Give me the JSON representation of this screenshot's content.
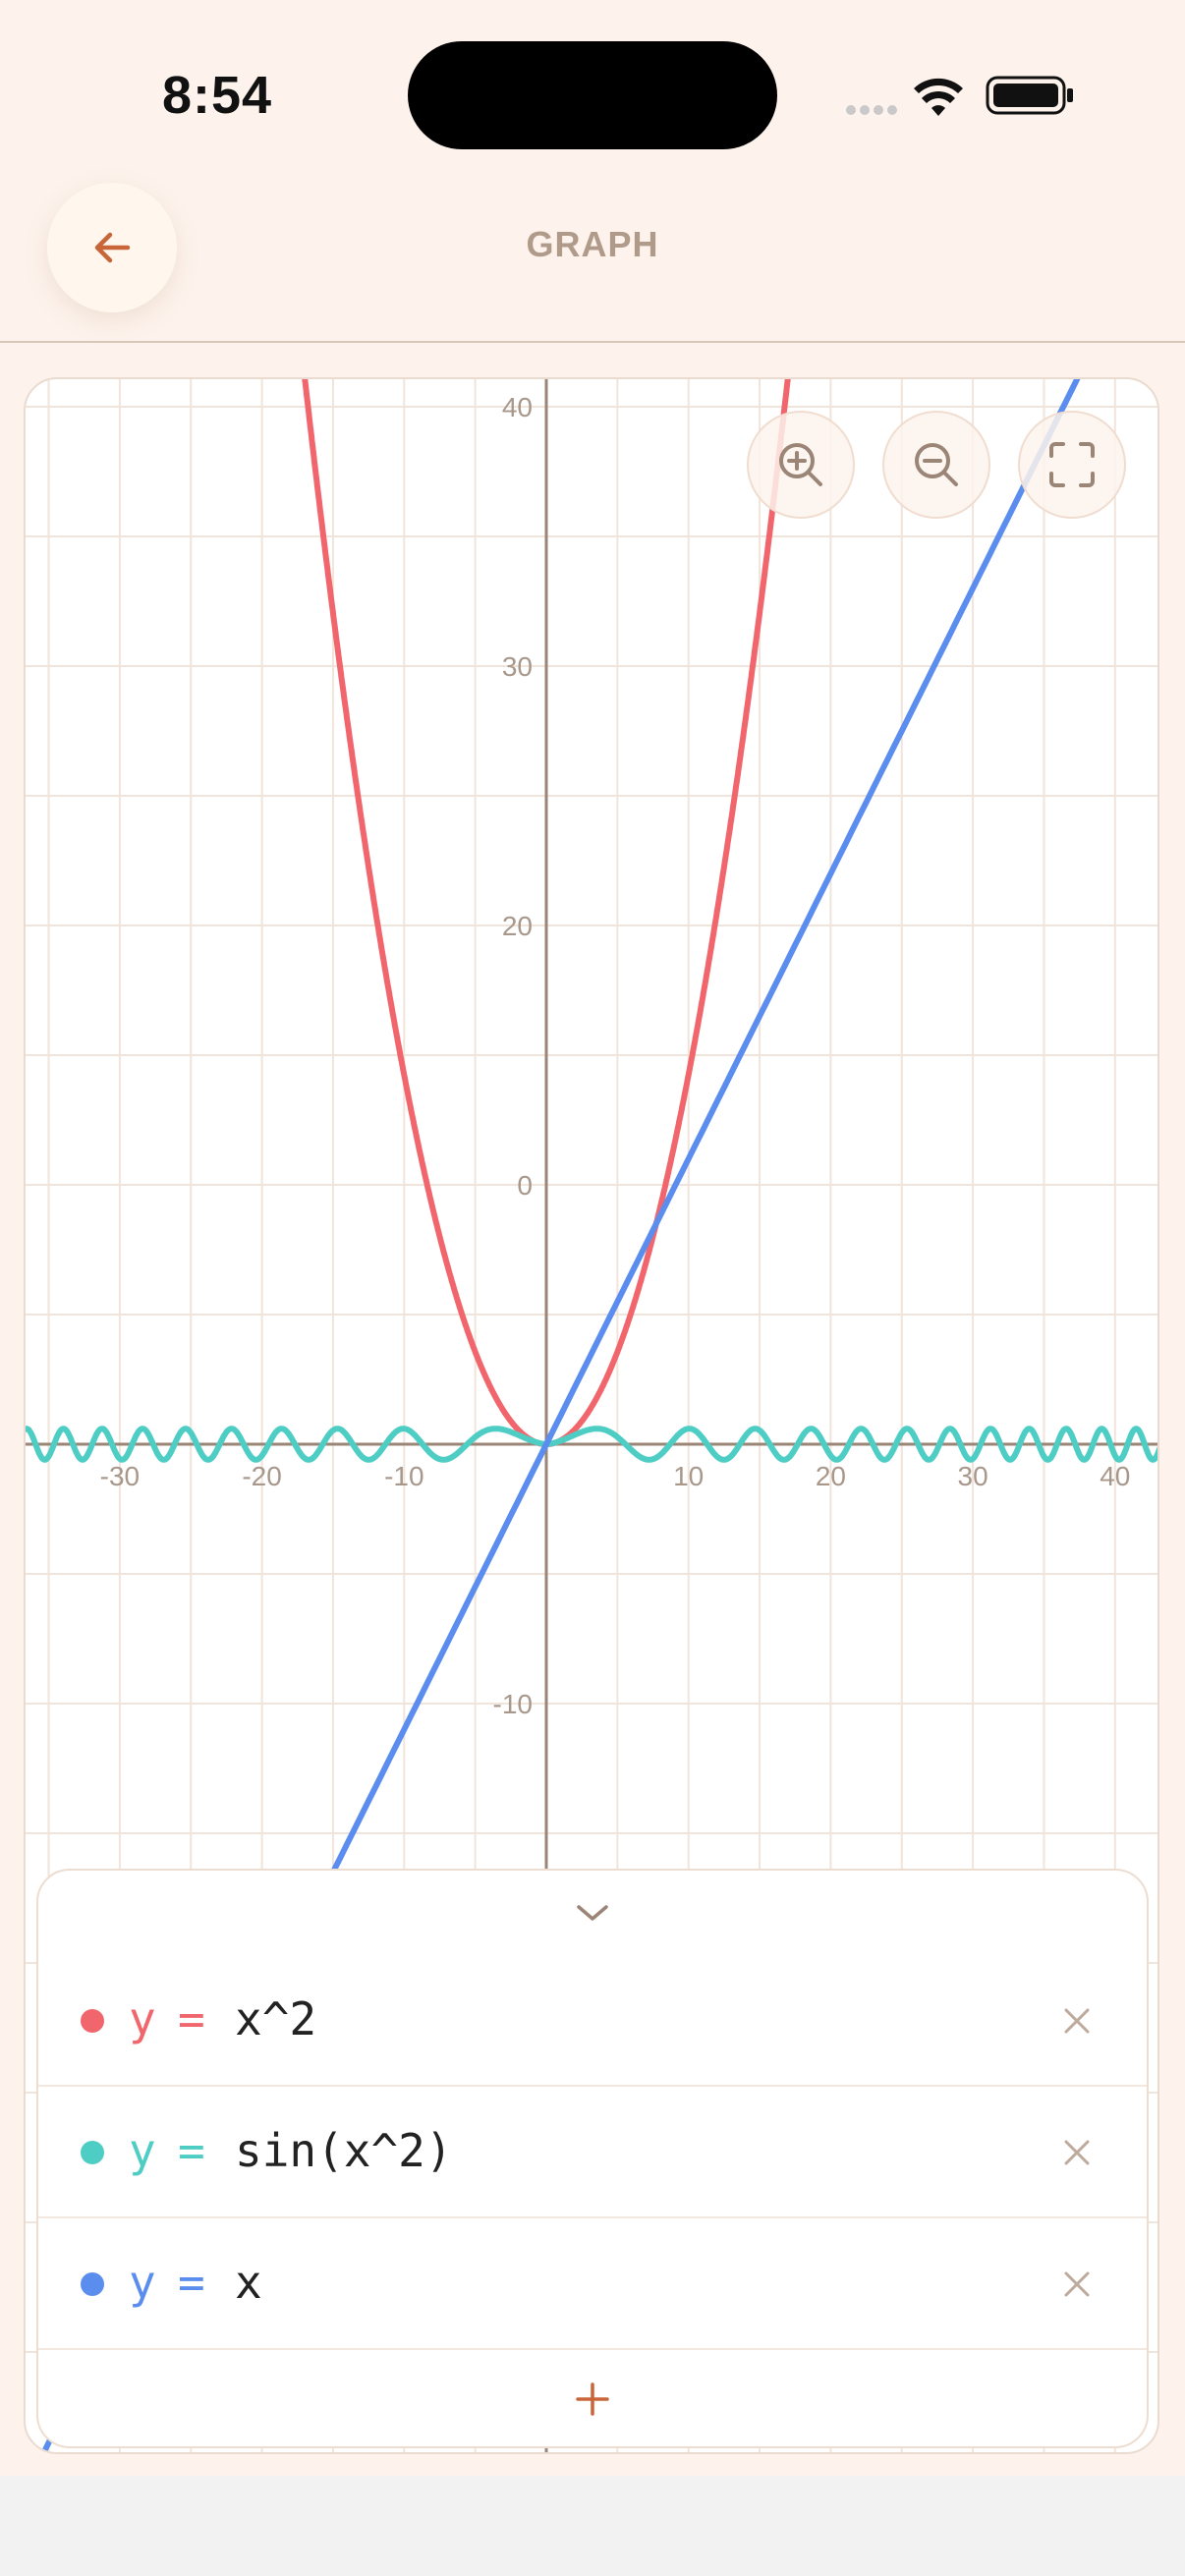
{
  "status_bar": {
    "time": "8:54",
    "signal_icon": "signal-dots-icon",
    "wifi_icon": "wifi-icon",
    "battery_icon": "battery-icon"
  },
  "header": {
    "title": "GRAPH",
    "back_icon": "arrow-left-icon",
    "accent_color": "#c8663a"
  },
  "toolbar": {
    "zoom_in_icon": "zoom-in-icon",
    "zoom_out_icon": "zoom-out-icon",
    "fullscreen_icon": "fullscreen-icon"
  },
  "chart_data": {
    "type": "line",
    "xlim": [
      -37,
      43
    ],
    "ylim": [
      -17,
      41
    ],
    "grid": true,
    "x_ticks": [
      -30,
      -20,
      -10,
      10,
      20,
      30,
      40
    ],
    "y_ticks": [
      40,
      30,
      20,
      0,
      -10
    ],
    "y_tick_labels": [
      "40",
      "30",
      "20",
      "0",
      "-10"
    ],
    "series": [
      {
        "name": "y = x^2",
        "color": "#f0666c",
        "function": "x^2"
      },
      {
        "name": "y = sin(x^2)",
        "color": "#4ecdc4",
        "function": "sin(x^2)"
      },
      {
        "name": "y = x",
        "color": "#5b8def",
        "function": "x"
      }
    ]
  },
  "functions": [
    {
      "var": "y",
      "eq": "=",
      "expr": "x^2",
      "color": "#f0666c",
      "remove_icon": "close-icon"
    },
    {
      "var": "y",
      "eq": "=",
      "expr": "sin(x^2)",
      "color": "#4ecdc4",
      "remove_icon": "close-icon"
    },
    {
      "var": "y",
      "eq": "=",
      "expr": "x",
      "color": "#5b8def",
      "remove_icon": "close-icon"
    }
  ],
  "panel": {
    "collapse_icon": "chevron-down-icon",
    "add_icon": "plus-icon"
  }
}
